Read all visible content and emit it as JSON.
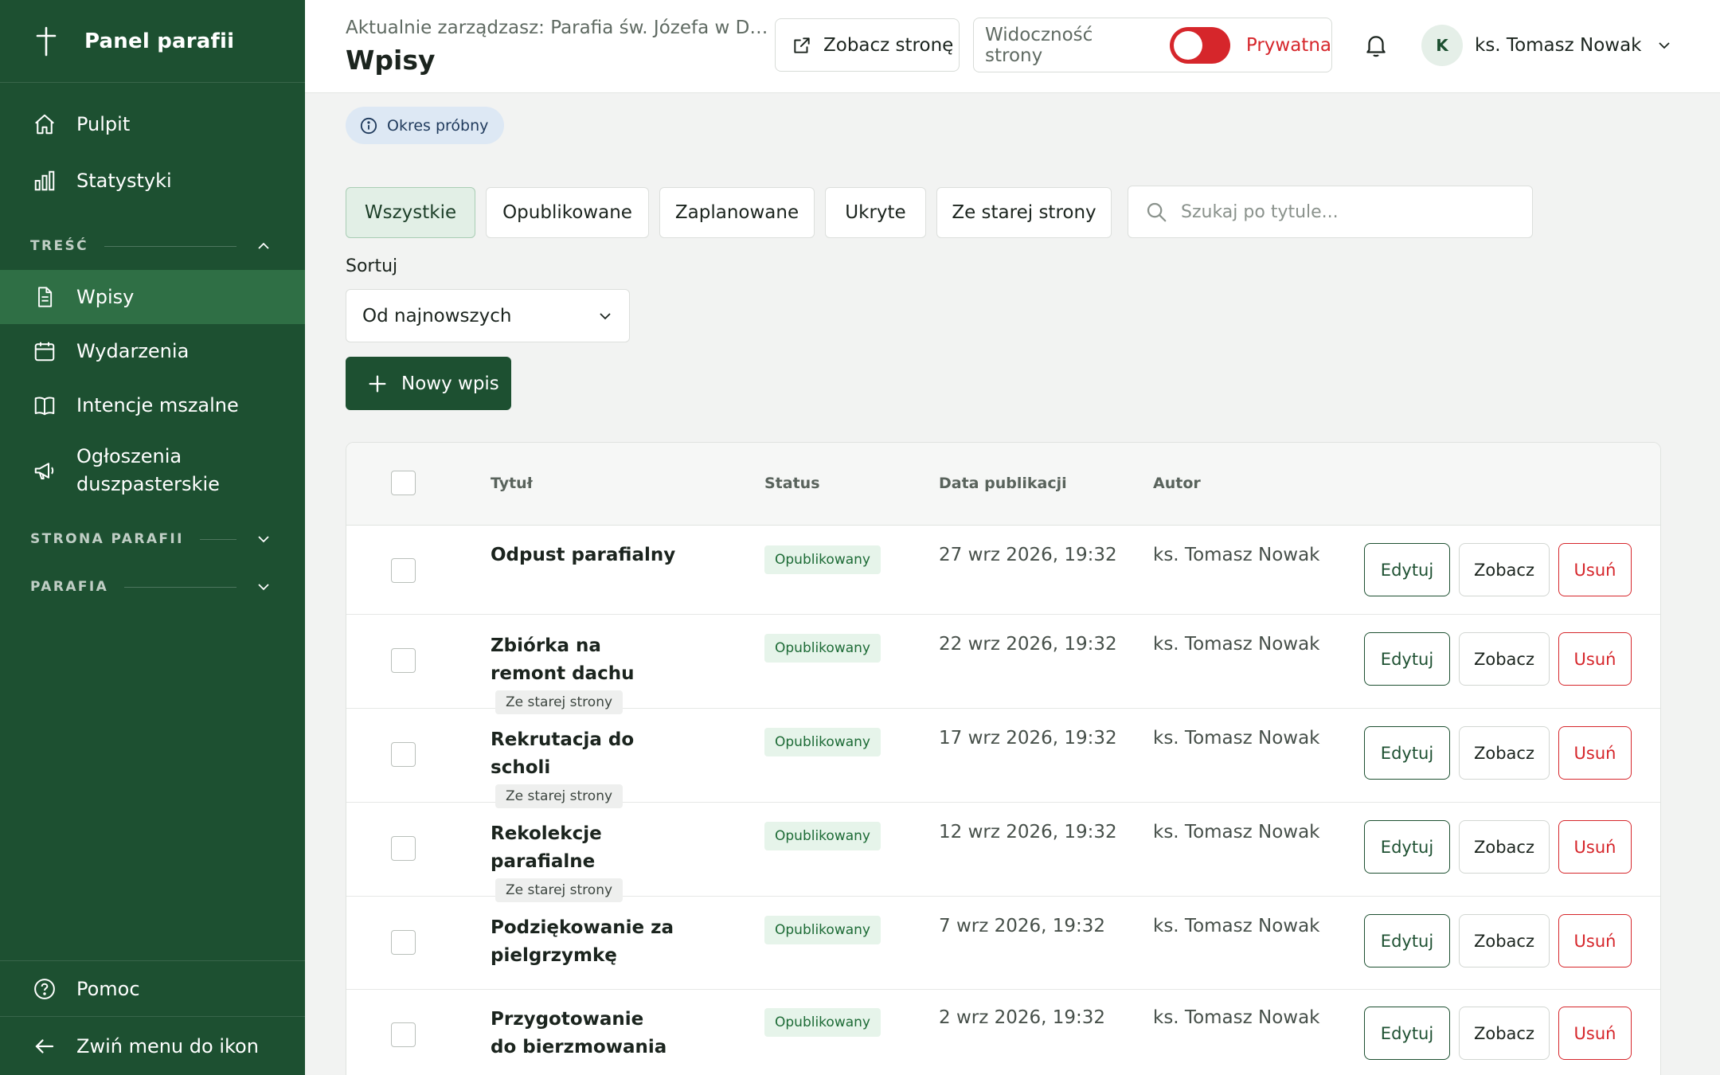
{
  "sidebar": {
    "brand": "Panel parafii",
    "items": [
      {
        "label": "Pulpit",
        "icon": "home-icon"
      },
      {
        "label": "Statystyki",
        "icon": "bar-chart-icon"
      }
    ],
    "section_content": "TREŚĆ",
    "content_items": [
      {
        "label": "Wpisy",
        "icon": "document-icon",
        "active": true
      },
      {
        "label": "Wydarzenia",
        "icon": "calendar-icon"
      },
      {
        "label": "Intencje mszalne",
        "icon": "book-icon"
      },
      {
        "label": "Ogłoszenia duszpasterskie",
        "icon": "megaphone-icon"
      }
    ],
    "section_site": "STRONA PARAFII",
    "section_parish": "PARAFIA",
    "help": "Pomoc",
    "collapse": "Zwiń menu do ikon"
  },
  "header": {
    "breadcrumb": "Aktualnie zarządzasz: Parafia św. Józefa w Dąbrowie",
    "title": "Wpisy",
    "view_site": "Zobacz stronę",
    "visibility_label": "Widoczność strony",
    "visibility_state": "Prywatna",
    "user_initial": "K",
    "user_name": "ks. Tomasz Nowak"
  },
  "trial_badge": "Okres próbny",
  "filters": [
    "Wszystkie",
    "Opublikowane",
    "Zaplanowane",
    "Ukryte",
    "Ze starej strony"
  ],
  "search": {
    "placeholder": "Szukaj po tytule..."
  },
  "sort": {
    "label": "Sortuj",
    "value": "Od najnowszych"
  },
  "new_post": "Nowy wpis",
  "table": {
    "columns": {
      "title": "Tytuł",
      "status": "Status",
      "date": "Data publikacji",
      "author": "Autor"
    },
    "actions": {
      "edit": "Edytuj",
      "view": "Zobacz",
      "delete": "Usuń"
    },
    "rows": [
      {
        "title": "Odpust parafialny",
        "tag": "",
        "status": "Opublikowany",
        "date": "27 wrz 2026, 19:32",
        "author": "ks. Tomasz Nowak"
      },
      {
        "title": "Zbiórka na remont dachu",
        "tag": "Ze starej strony",
        "status": "Opublikowany",
        "date": "22 wrz 2026, 19:32",
        "author": "ks. Tomasz Nowak"
      },
      {
        "title": "Rekrutacja do scholi",
        "tag": "Ze starej strony",
        "status": "Opublikowany",
        "date": "17 wrz 2026, 19:32",
        "author": "ks. Tomasz Nowak"
      },
      {
        "title": "Rekolekcje parafialne",
        "tag": "Ze starej strony",
        "status": "Opublikowany",
        "date": "12 wrz 2026, 19:32",
        "author": "ks. Tomasz Nowak"
      },
      {
        "title": "Podziękowanie za pielgrzymkę",
        "tag": "",
        "status": "Opublikowany",
        "date": "7 wrz 2026, 19:32",
        "author": "ks. Tomasz Nowak"
      },
      {
        "title": "Przygotowanie do bierzmowania",
        "tag": "",
        "status": "Opublikowany",
        "date": "2 wrz 2026, 19:32",
        "author": "ks. Tomasz Nowak"
      }
    ]
  },
  "colors": {
    "sidebar": "#1d5031",
    "active": "#2f6f45",
    "danger": "#d6262b",
    "accent": "#1d5031"
  }
}
